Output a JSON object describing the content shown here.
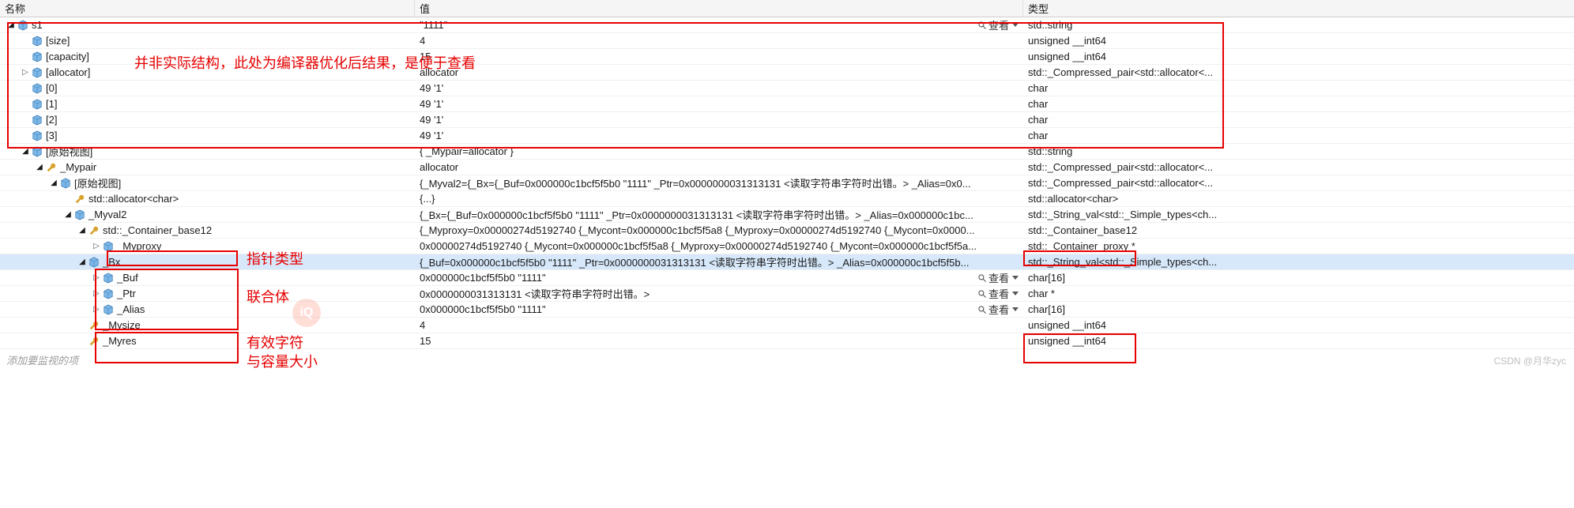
{
  "headers": {
    "name": "名称",
    "value": "值",
    "type": "类型"
  },
  "lookup_label": "查看",
  "hint": "添加要监视的项",
  "watermark": "CSDN @月华zyc",
  "annotations": {
    "top": "并非实际结构，此处为编译器优化后结果，是便于查看",
    "ptr": "指针类型",
    "union": "联合体",
    "valid": "有效字符",
    "valid2": "与容量大小"
  },
  "rows": [
    {
      "depth": 0,
      "expander": "open",
      "icon": "cube",
      "name": "s1",
      "value": "\"1111\"",
      "type": "std::string",
      "lookup": true
    },
    {
      "depth": 1,
      "expander": "none",
      "icon": "cube",
      "name": "[size]",
      "value": "4",
      "type": "unsigned __int64"
    },
    {
      "depth": 1,
      "expander": "none",
      "icon": "cube",
      "name": "[capacity]",
      "value": "15",
      "type": "unsigned __int64"
    },
    {
      "depth": 1,
      "expander": "closed",
      "icon": "cube",
      "name": "[allocator]",
      "value": "allocator",
      "type": "std::_Compressed_pair<std::allocator<..."
    },
    {
      "depth": 1,
      "expander": "none",
      "icon": "cube",
      "name": "[0]",
      "value": "49 '1'",
      "type": "char"
    },
    {
      "depth": 1,
      "expander": "none",
      "icon": "cube",
      "name": "[1]",
      "value": "49 '1'",
      "type": "char"
    },
    {
      "depth": 1,
      "expander": "none",
      "icon": "cube",
      "name": "[2]",
      "value": "49 '1'",
      "type": "char"
    },
    {
      "depth": 1,
      "expander": "none",
      "icon": "cube",
      "name": "[3]",
      "value": "49 '1'",
      "type": "char"
    },
    {
      "depth": 1,
      "expander": "open",
      "icon": "cube",
      "name": "[原始视图]",
      "value": "{ _Mypair=allocator }",
      "type": "std::string"
    },
    {
      "depth": 2,
      "expander": "open",
      "icon": "wrench",
      "name": "_Mypair",
      "value": "allocator",
      "type": "std::_Compressed_pair<std::allocator<..."
    },
    {
      "depth": 3,
      "expander": "open",
      "icon": "cube",
      "name": "[原始视图]",
      "value": "{_Myval2={_Bx={_Buf=0x000000c1bcf5f5b0 \"1111\" _Ptr=0x0000000031313131 <读取字符串字符时出错。> _Alias=0x0...",
      "type": "std::_Compressed_pair<std::allocator<..."
    },
    {
      "depth": 4,
      "expander": "none",
      "icon": "wrench",
      "name": "std::allocator<char>",
      "value": "{...}",
      "type": "std::allocator<char>"
    },
    {
      "depth": 4,
      "expander": "open",
      "icon": "cube",
      "name": "_Myval2",
      "value": "{_Bx={_Buf=0x000000c1bcf5f5b0 \"1111\" _Ptr=0x0000000031313131 <读取字符串字符时出错。> _Alias=0x000000c1bc...",
      "type": "std::_String_val<std::_Simple_types<ch..."
    },
    {
      "depth": 5,
      "expander": "open",
      "icon": "wrench",
      "name": "std::_Container_base12",
      "value": "{_Myproxy=0x00000274d5192740 {_Mycont=0x000000c1bcf5f5a8 {_Myproxy=0x00000274d5192740 {_Mycont=0x0000...",
      "type": "std::_Container_base12"
    },
    {
      "depth": 6,
      "expander": "closed",
      "icon": "cube",
      "name": "_Myproxy",
      "value": "0x00000274d5192740 {_Mycont=0x000000c1bcf5f5a8 {_Myproxy=0x00000274d5192740 {_Mycont=0x000000c1bcf5f5a...",
      "type": "std::_Container_proxy *"
    },
    {
      "depth": 5,
      "expander": "open",
      "icon": "cube",
      "name": "_Bx",
      "value": "{_Buf=0x000000c1bcf5f5b0 \"1111\" _Ptr=0x0000000031313131 <读取字符串字符时出错。> _Alias=0x000000c1bcf5f5b...",
      "type": "std::_String_val<std::_Simple_types<ch...",
      "selected": true
    },
    {
      "depth": 6,
      "expander": "closed",
      "icon": "cube",
      "name": "_Buf",
      "value": "0x000000c1bcf5f5b0 \"1111\"",
      "type": "char[16]",
      "lookup": true
    },
    {
      "depth": 6,
      "expander": "closed",
      "icon": "cube",
      "name": "_Ptr",
      "value": "0x0000000031313131 <读取字符串字符时出错。>",
      "type": "char *",
      "lookup": true
    },
    {
      "depth": 6,
      "expander": "closed",
      "icon": "cube",
      "name": "_Alias",
      "value": "0x000000c1bcf5f5b0 \"1111\"",
      "type": "char[16]",
      "lookup": true
    },
    {
      "depth": 5,
      "expander": "none",
      "icon": "wrench",
      "name": "_Mysize",
      "value": "4",
      "type": "unsigned __int64"
    },
    {
      "depth": 5,
      "expander": "none",
      "icon": "wrench",
      "name": "_Myres",
      "value": "15",
      "type": "unsigned __int64"
    }
  ]
}
